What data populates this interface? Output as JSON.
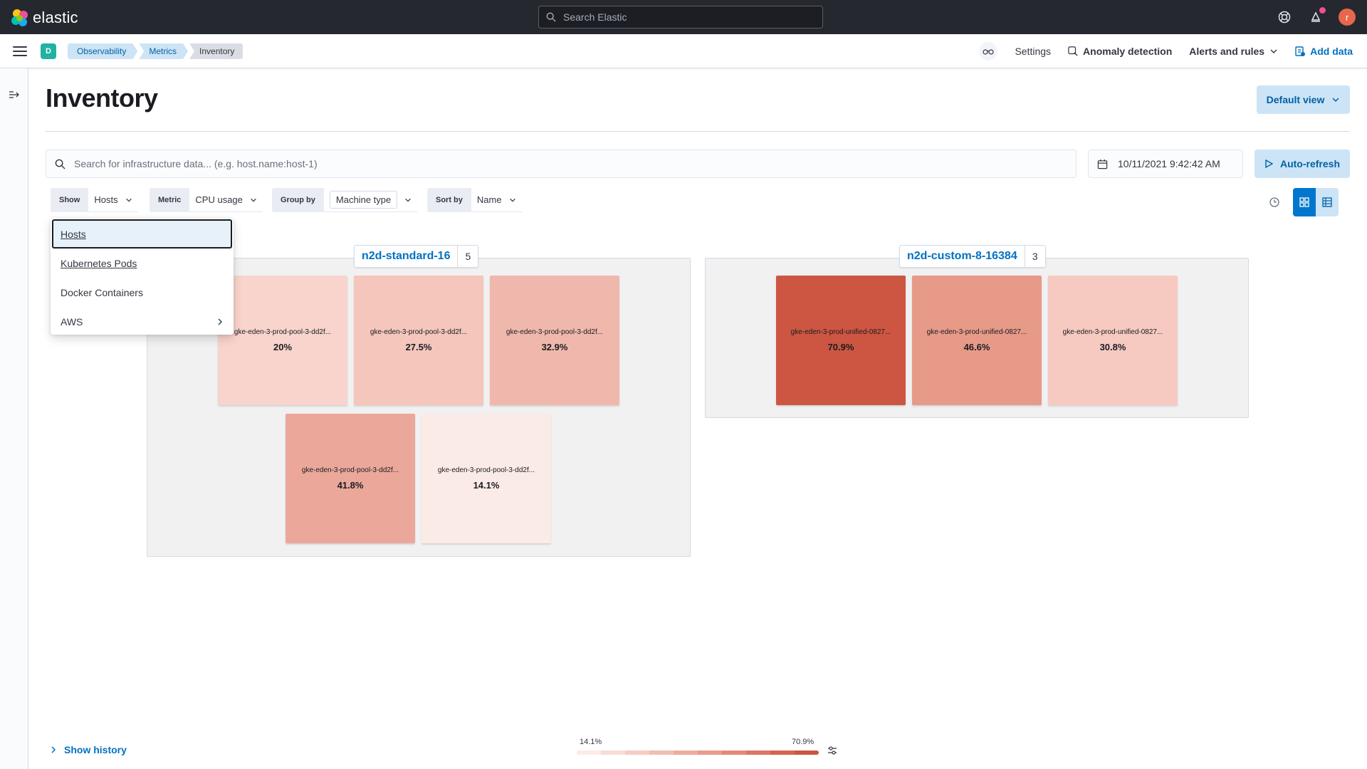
{
  "header": {
    "brand": "elastic",
    "search_placeholder": "Search Elastic",
    "avatar_initial": "r"
  },
  "subheader": {
    "space_initial": "D",
    "breadcrumbs": [
      "Observability",
      "Metrics",
      "Inventory"
    ],
    "links": {
      "settings": "Settings",
      "anomaly": "Anomaly detection",
      "alerts": "Alerts and rules",
      "add_data": "Add data"
    }
  },
  "page": {
    "title": "Inventory",
    "default_view": "Default view",
    "search_placeholder": "Search for infrastructure data... (e.g. host.name:host-1)",
    "date": "10/11/2021 9:42:42 AM",
    "auto_refresh": "Auto-refresh"
  },
  "toolbar": {
    "show_label": "Show",
    "show_value": "Hosts",
    "metric_label": "Metric",
    "metric_value": "CPU usage",
    "group_label": "Group by",
    "group_value": "Machine type",
    "sort_label": "Sort by",
    "sort_value": "Name"
  },
  "dropdown": {
    "items": [
      "Hosts",
      "Kubernetes Pods",
      "Docker Containers",
      "AWS"
    ]
  },
  "groups": [
    {
      "name": "n2d-standard-16",
      "count": "5",
      "nodes": [
        {
          "name": "gke-eden-3-prod-pool-3-dd2f...",
          "value": "20%",
          "color": "#f8d4cc"
        },
        {
          "name": "gke-eden-3-prod-pool-3-dd2f...",
          "value": "27.5%",
          "color": "#f5c6bc"
        },
        {
          "name": "gke-eden-3-prod-pool-3-dd2f...",
          "value": "32.9%",
          "color": "#f0b8ac"
        },
        {
          "name": "gke-eden-3-prod-pool-3-dd2f...",
          "value": "41.8%",
          "color": "#eba89a"
        },
        {
          "name": "gke-eden-3-prod-pool-3-dd2f...",
          "value": "14.1%",
          "color": "#fbebe7"
        }
      ]
    },
    {
      "name": "n2d-custom-8-16384",
      "count": "3",
      "nodes": [
        {
          "name": "gke-eden-3-prod-unified-0827...",
          "value": "70.9%",
          "color": "#cc5642"
        },
        {
          "name": "gke-eden-3-prod-unified-0827...",
          "value": "46.6%",
          "color": "#e79a88"
        },
        {
          "name": "gke-eden-3-prod-unified-0827...",
          "value": "30.8%",
          "color": "#f6cac1"
        }
      ]
    }
  ],
  "legend": {
    "min": "14.1%",
    "max": "70.9%",
    "colors": [
      "#fbebe7",
      "#f8dcd6",
      "#f5cdc4",
      "#f2bdb2",
      "#eeac9f",
      "#ea9b8b",
      "#e38a77",
      "#dc7763",
      "#d4654f",
      "#cc5642"
    ]
  },
  "footer": {
    "show_history": "Show history"
  }
}
